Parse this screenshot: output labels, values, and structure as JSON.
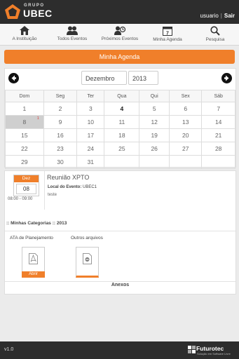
{
  "header": {
    "logo_grupo": "GRUPO",
    "logo_name": "UBEC",
    "user_name": "usuario",
    "user_sep": "|",
    "logout": "Sair"
  },
  "nav": [
    {
      "label": "A Instituição",
      "icon": "institution-icon"
    },
    {
      "label": "Todos Eventos",
      "icon": "people-icon"
    },
    {
      "label": "Próximos Eventos",
      "icon": "people-next-icon"
    },
    {
      "label": "Minha Agenda",
      "icon": "calendar-icon"
    },
    {
      "label": "Pesquisa",
      "icon": "search-icon"
    }
  ],
  "page_title": "Minha Agenda",
  "calendar": {
    "month": "Dezembro",
    "year": "2013",
    "calendar_icon_day": "7",
    "weekdays": [
      "Dom",
      "Seg",
      "Ter",
      "Qua",
      "Qui",
      "Sex",
      "Sáb"
    ],
    "weeks": [
      [
        "1",
        "2",
        "3",
        "4",
        "5",
        "6",
        "7"
      ],
      [
        "8",
        "9",
        "10",
        "11",
        "12",
        "13",
        "14"
      ],
      [
        "15",
        "16",
        "17",
        "18",
        "19",
        "20",
        "21"
      ],
      [
        "22",
        "23",
        "24",
        "25",
        "26",
        "27",
        "28"
      ],
      [
        "29",
        "30",
        "31",
        "",
        "",
        "",
        ""
      ]
    ],
    "today": "8",
    "event_marker": "1",
    "bold_day": "4"
  },
  "event": {
    "month": "Dez",
    "day": "08",
    "time": "08:00 - 09:00",
    "title": "Reunião XPTO",
    "location_label": "Local do Evento:",
    "location_value": "UBEC1",
    "description": "teste"
  },
  "categories": {
    "label": ":: Minhas Categorias ::",
    "year": "2013"
  },
  "files": {
    "col1_label": "ATA de Planejamento",
    "col1_button": "Abrir",
    "col2_label": "Outros arquivos"
  },
  "anexos_label": "Anexos",
  "footer": {
    "version": "v1.0",
    "brand": "Futurotec",
    "brand_sub": "Solução em Software Livre"
  },
  "colors": {
    "accent": "#f07f2a",
    "bar": "#2d2d2d"
  }
}
